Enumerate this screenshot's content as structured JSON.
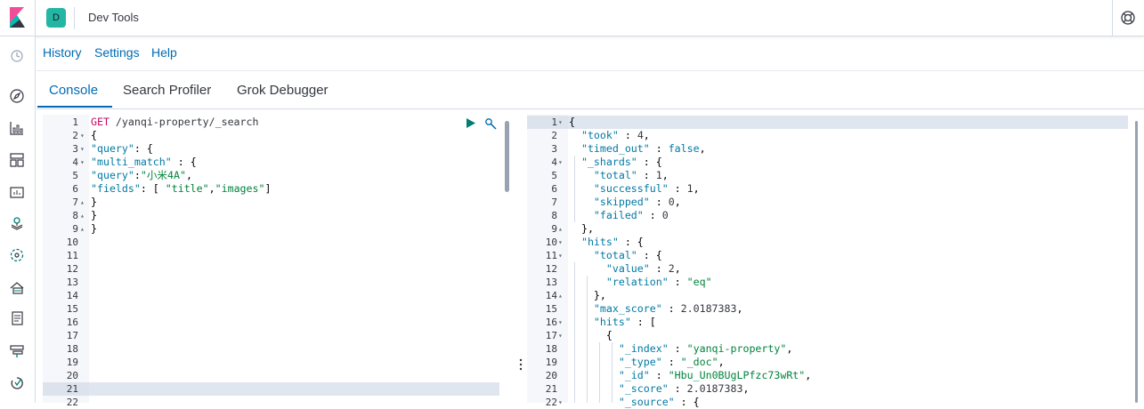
{
  "header": {
    "space_initial": "D",
    "app_title": "Dev Tools"
  },
  "menu": {
    "history": "History",
    "settings": "Settings",
    "help": "Help"
  },
  "tabs": [
    "Console",
    "Search Profiler",
    "Grok Debugger"
  ],
  "sidebar_icons": [
    "clock-icon",
    "compass-icon",
    "visualize-icon",
    "dashboard-icon",
    "canvas-icon",
    "maps-icon",
    "ml-icon",
    "infrastructure-icon",
    "logs-icon",
    "apm-icon",
    "uptime-icon"
  ],
  "request": {
    "method": "GET",
    "path": " /yanqi-property/_search",
    "lines": [
      "{",
      "\"query\": {",
      "\"multi_match\" : {",
      "\"query\":\"小米4A\",",
      "\"fields\": [ \"title\",\"images\"]",
      "}",
      "}",
      "}"
    ],
    "line_numbers": [
      "1",
      "2",
      "3",
      "4",
      "5",
      "6",
      "7",
      "8",
      "9",
      "10",
      "11",
      "12",
      "13",
      "14",
      "15",
      "16",
      "17",
      "18",
      "19",
      "20",
      "21",
      "22"
    ]
  },
  "response": {
    "lines": [
      "{",
      "  \"took\" : 4,",
      "  \"timed_out\" : false,",
      "  \"_shards\" : {",
      "    \"total\" : 1,",
      "    \"successful\" : 1,",
      "    \"skipped\" : 0,",
      "    \"failed\" : 0",
      "  },",
      "  \"hits\" : {",
      "    \"total\" : {",
      "      \"value\" : 2,",
      "      \"relation\" : \"eq\"",
      "    },",
      "    \"max_score\" : 2.0187383,",
      "    \"hits\" : [",
      "      {",
      "        \"_index\" : \"yanqi-property\",",
      "        \"_type\" : \"_doc\",",
      "        \"_id\" : \"Hbu_Un0BUgLPfzc73wRt\",",
      "        \"_score\" : 2.0187383,",
      "        \"_source\" : {"
    ],
    "line_numbers": [
      "1",
      "2",
      "3",
      "4",
      "5",
      "6",
      "7",
      "8",
      "9",
      "10",
      "11",
      "12",
      "13",
      "14",
      "15",
      "16",
      "17",
      "18",
      "19",
      "20",
      "21",
      "22"
    ]
  },
  "colors": {
    "accent": "#006bb4",
    "string": "#00833c",
    "key": "#0079a5",
    "method": "#c80a68",
    "run": "#017d73"
  }
}
